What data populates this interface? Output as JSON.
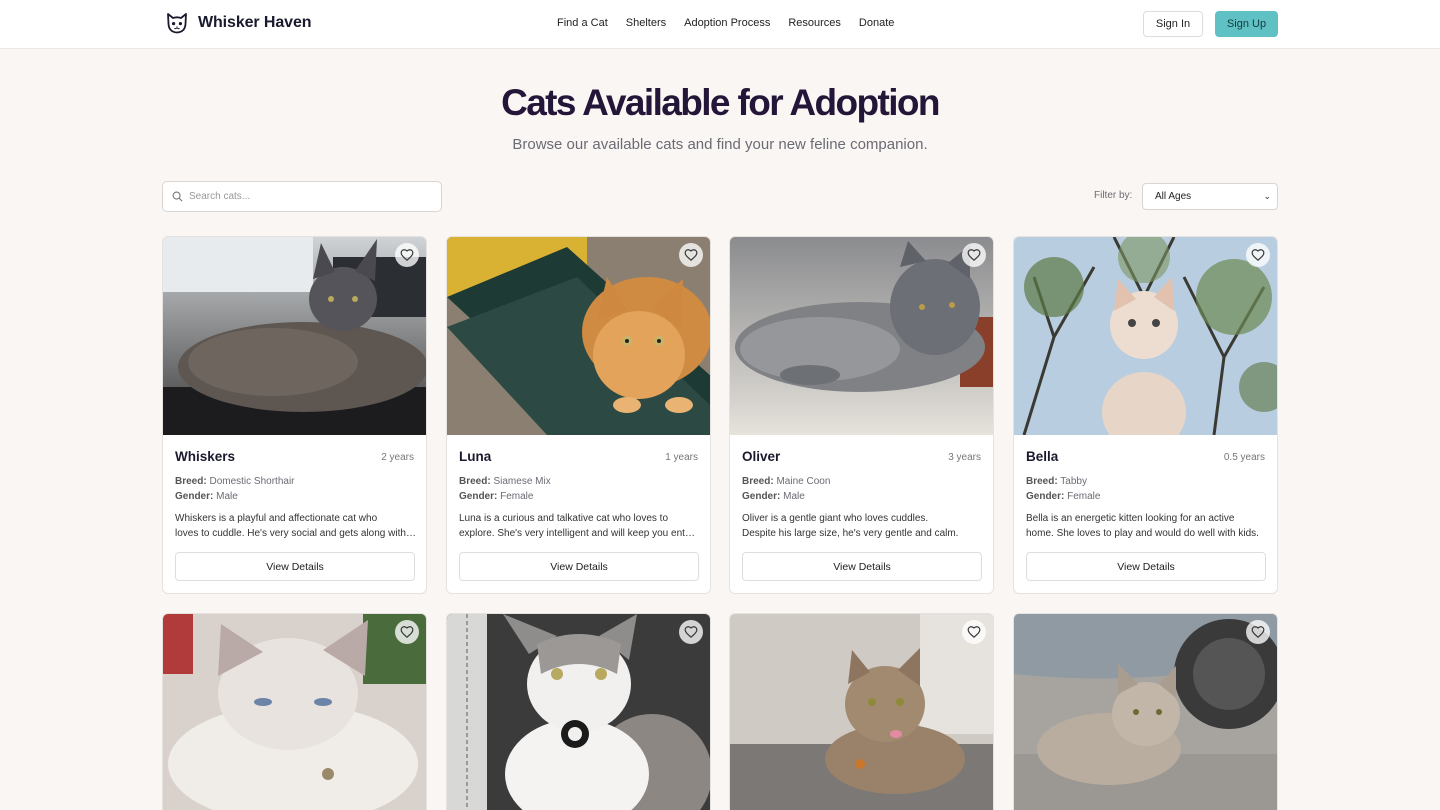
{
  "header": {
    "brand": "Whisker Haven",
    "nav": [
      "Find a Cat",
      "Shelters",
      "Adoption Process",
      "Resources",
      "Donate"
    ],
    "sign_in": "Sign In",
    "sign_up": "Sign Up"
  },
  "hero": {
    "title": "Cats Available for Adoption",
    "subtitle": "Browse our available cats and find your new feline companion."
  },
  "controls": {
    "search_placeholder": "Search cats...",
    "filter_label": "Filter by:",
    "filter_value": "All Ages"
  },
  "labels": {
    "breed": "Breed:",
    "gender": "Gender:",
    "view_details": "View Details"
  },
  "cats": [
    {
      "name": "Whiskers",
      "age": "2 years",
      "breed": "Domestic Shorthair",
      "gender": "Male",
      "desc1": "Whiskers is a playful and affectionate cat who",
      "desc2": "loves to cuddle. He's very social and gets along with other pets."
    },
    {
      "name": "Luna",
      "age": "1 years",
      "breed": "Siamese Mix",
      "gender": "Female",
      "desc1": "Luna is a curious and talkative cat who loves to",
      "desc2": "explore. She's very intelligent and will keep you entertained."
    },
    {
      "name": "Oliver",
      "age": "3 years",
      "breed": "Maine Coon",
      "gender": "Male",
      "desc1": "Oliver is a gentle giant who loves cuddles.",
      "desc2": "Despite his large size, he's very gentle and calm."
    },
    {
      "name": "Bella",
      "age": "0.5 years",
      "breed": "Tabby",
      "gender": "Female",
      "desc1": "Bella is an energetic kitten looking for an active",
      "desc2": "home. She loves to play and would do well with kids."
    },
    {
      "name": "",
      "age": "",
      "breed": "",
      "gender": "",
      "desc1": "",
      "desc2": ""
    },
    {
      "name": "",
      "age": "",
      "breed": "",
      "gender": "",
      "desc1": "",
      "desc2": ""
    },
    {
      "name": "",
      "age": "",
      "breed": "",
      "gender": "",
      "desc1": "",
      "desc2": ""
    },
    {
      "name": "",
      "age": "",
      "breed": "",
      "gender": "",
      "desc1": "",
      "desc2": ""
    }
  ],
  "colors": {
    "accent": "#5fc1c3",
    "title": "#241638",
    "background": "#faf6f3"
  }
}
